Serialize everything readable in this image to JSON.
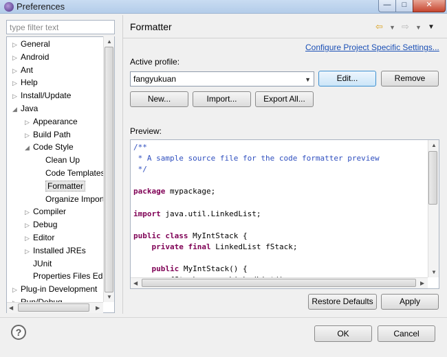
{
  "window": {
    "title": "Preferences",
    "min": "—",
    "max": "□",
    "close": "✕"
  },
  "filter": {
    "placeholder": "type filter text"
  },
  "tree": [
    {
      "label": "General",
      "arrow": "▷"
    },
    {
      "label": "Android",
      "arrow": "▷"
    },
    {
      "label": "Ant",
      "arrow": "▷"
    },
    {
      "label": "Help",
      "arrow": "▷"
    },
    {
      "label": "Install/Update",
      "arrow": "▷"
    },
    {
      "label": "Java",
      "arrow": "◢"
    },
    {
      "label": "Appearance",
      "arrow": "▷"
    },
    {
      "label": "Build Path",
      "arrow": "▷"
    },
    {
      "label": "Code Style",
      "arrow": "◢"
    },
    {
      "label": "Clean Up",
      "arrow": ""
    },
    {
      "label": "Code Templates",
      "arrow": ""
    },
    {
      "label": "Formatter",
      "arrow": "",
      "selected": true
    },
    {
      "label": "Organize Imports",
      "arrow": ""
    },
    {
      "label": "Compiler",
      "arrow": "▷"
    },
    {
      "label": "Debug",
      "arrow": "▷"
    },
    {
      "label": "Editor",
      "arrow": "▷"
    },
    {
      "label": "Installed JREs",
      "arrow": "▷"
    },
    {
      "label": "JUnit",
      "arrow": ""
    },
    {
      "label": "Properties Files Editor",
      "arrow": ""
    },
    {
      "label": "Plug-in Development",
      "arrow": "▷"
    },
    {
      "label": "Run/Debug",
      "arrow": "▷"
    }
  ],
  "page": {
    "title": "Formatter",
    "configure_link": "Configure Project Specific Settings...",
    "active_profile_label": "Active profile:",
    "active_profile_value": "fangyukuan",
    "preview_label": "Preview:"
  },
  "buttons": {
    "edit": "Edit...",
    "remove": "Remove",
    "new": "New...",
    "import": "Import...",
    "export_all": "Export All...",
    "restore_defaults": "Restore Defaults",
    "apply": "Apply",
    "ok": "OK",
    "cancel": "Cancel",
    "help": "?"
  },
  "preview_code": [
    [
      {
        "t": "/**",
        "c": "comment"
      }
    ],
    [
      {
        "t": " * A sample source file for the code formatter preview",
        "c": "comment"
      }
    ],
    [
      {
        "t": " */",
        "c": "comment"
      }
    ],
    [],
    [
      {
        "t": "package",
        "c": "kw"
      },
      {
        "t": " mypackage;",
        "c": "plain"
      }
    ],
    [],
    [
      {
        "t": "import",
        "c": "kw"
      },
      {
        "t": " java.util.LinkedList;",
        "c": "plain"
      }
    ],
    [],
    [
      {
        "t": "public",
        "c": "kw"
      },
      {
        "t": " ",
        "c": "plain"
      },
      {
        "t": "class",
        "c": "kw"
      },
      {
        "t": " MyIntStack {",
        "c": "plain"
      }
    ],
    [
      {
        "t": "    ",
        "c": "plain"
      },
      {
        "t": "private",
        "c": "kw"
      },
      {
        "t": " ",
        "c": "plain"
      },
      {
        "t": "final",
        "c": "kw"
      },
      {
        "t": " LinkedList fStack;",
        "c": "plain"
      }
    ],
    [],
    [
      {
        "t": "    ",
        "c": "plain"
      },
      {
        "t": "public",
        "c": "kw"
      },
      {
        "t": " MyIntStack() {",
        "c": "plain"
      }
    ],
    [
      {
        "t": "        fStack = ",
        "c": "plain"
      },
      {
        "t": "new",
        "c": "kw"
      },
      {
        "t": " LinkedList();",
        "c": "plain"
      }
    ]
  ]
}
